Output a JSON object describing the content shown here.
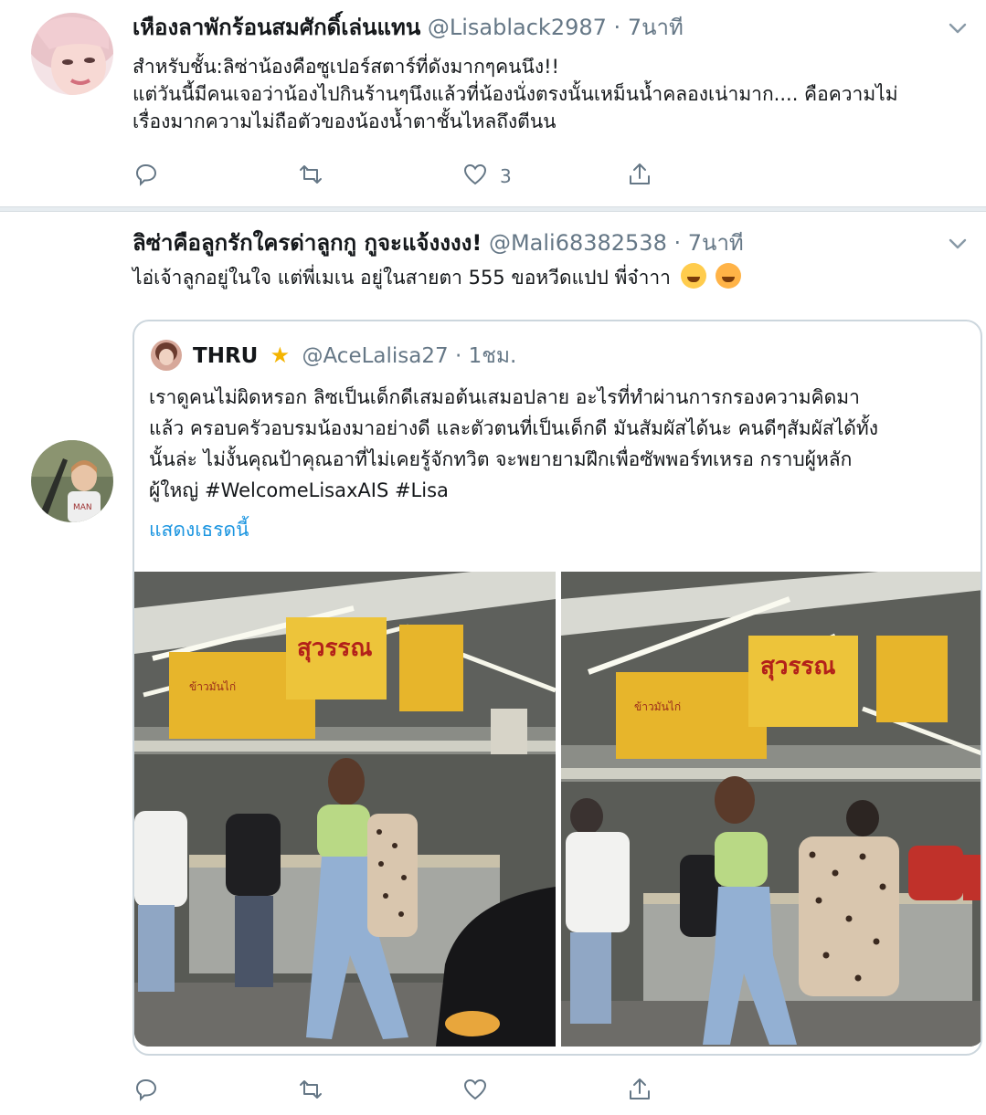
{
  "tweets": [
    {
      "display_name": "เหืองลาพักร้อนสมศักดิ์เล่นแทน",
      "handle": "@Lisablack2987",
      "dot": "·",
      "time": "7นาที",
      "text": "สำหรับชั้น:ลิซ่าน้องคือซูเปอร์สตาร์ที่ดังมากๆคนนึง!!\nแต่วันนี้มีคนเจอว่าน้องไปกินร้านๆนึงแล้วที่น้องนั่งตรงนั้นเหม็นน้ำคลองเน่ามาก.... คือความไม่\nเรื่องมากความไม่ถือตัวของน้องน้ำตาชั้นไหลถึงตีนน",
      "like_count": "3"
    },
    {
      "display_name": "ลิซ่าคือลูกรักใครด่าลูกกู กูจะแจ้งงงง!",
      "handle": "@Mali68382538",
      "dot": "·",
      "time": "7นาที",
      "text": "ไอ่เจ้าลูกอยู่ในใจ แต่พี่เมเน อยู่ในสายตา 555 ขอหวีดแปป พี่จ๋าาา",
      "emojis": [
        "face-with-tears-of-joy",
        "smiling-face-with-hearts"
      ],
      "quote": {
        "display_name": "THRU",
        "badge": "★",
        "handle": "@AceLalisa27",
        "dot": "·",
        "time": "1ชม.",
        "text": "เราดูคนไม่ผิดหรอก ลิซเป็นเด็กดีเสมอต้นเสมอปลาย อะไรที่ทำผ่านการกรองความคิดมา\nแล้ว ครอบครัวอบรมน้องมาอย่างดี และตัวตนที่เป็นเด็กดี มันสัมผัสได้นะ คนดีๆสัมผัสได้ทั้ง\nนั้นล่ะ ไม่งั้นคุณป้าคุณอาที่ไม่เคยรู้จักทวิต จะพยายามฝึกเพื่อซัพพอร์ทเหรอ กราบผู้หลัก\nผู้ใหญ่ #WelcomeLisaxAIS #Lisa",
        "show_thread": "แสดงเธรดนี้",
        "photos": [
          {
            "sign_text": "สุวรรณ",
            "sign_small": "ข้าวมันไก่"
          },
          {
            "sign_text": "สุวรรณ",
            "sign_small": "ข้าวมันไก่"
          }
        ]
      }
    }
  ],
  "icons": {
    "reply": "reply-icon",
    "retweet": "retweet-icon",
    "like": "heart-icon",
    "share": "share-icon",
    "more": "chevron-down-icon"
  },
  "colors": {
    "text": "#14171a",
    "secondary": "#657786",
    "link": "#1b95e0",
    "border": "#ccd6dd",
    "star": "#f4b400"
  }
}
